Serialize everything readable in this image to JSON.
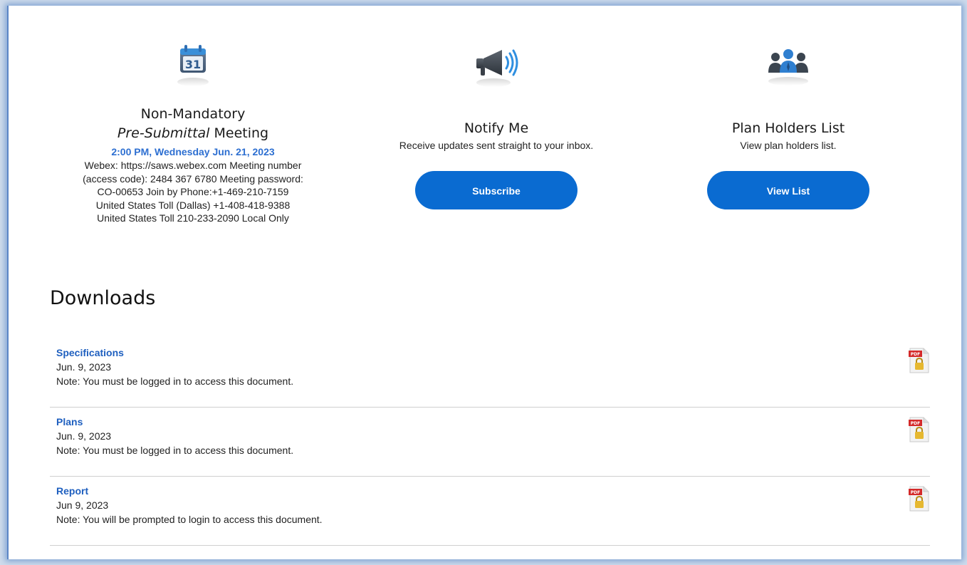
{
  "meeting": {
    "title_line1": "Non-Mandatory",
    "title_italic": "Pre-Submittal",
    "title_rest": " Meeting",
    "calendar_day": "31",
    "time": "2:00 PM, Wednesday Jun. 21, 2023",
    "details": [
      "Webex: https://saws.webex.com Meeting number",
      "(access code): 2484 367 6780 Meeting password:",
      "CO-00653 Join by Phone:+1-469-210-7159",
      "United States Toll (Dallas) +1-408-418-9388",
      "United States Toll 210-233-2090 Local Only"
    ]
  },
  "notify": {
    "title": "Notify Me",
    "text": "Receive updates sent straight to your inbox.",
    "button": "Subscribe"
  },
  "plan_holders": {
    "title": "Plan Holders List",
    "text": "View plan holders list.",
    "button": "View List"
  },
  "downloads": {
    "title": "Downloads",
    "pdf_badge": "PDF",
    "items": [
      {
        "name": "Specifications",
        "date": "Jun. 9, 2023",
        "note": "Note: You must be logged in to access this document."
      },
      {
        "name": "Plans",
        "date": "Jun. 9, 2023",
        "note": "Note: You must be logged in to access this document."
      },
      {
        "name": "Report",
        "date": "Jun 9, 2023",
        "note": "Note: You will be prompted to login to access this document."
      }
    ]
  },
  "colors": {
    "accent": "#0a6bd1",
    "link": "#1e5fbf",
    "time": "#2d6fd1"
  },
  "icons": [
    "calendar-icon",
    "megaphone-icon",
    "users-icon",
    "pdf-lock-icon"
  ]
}
